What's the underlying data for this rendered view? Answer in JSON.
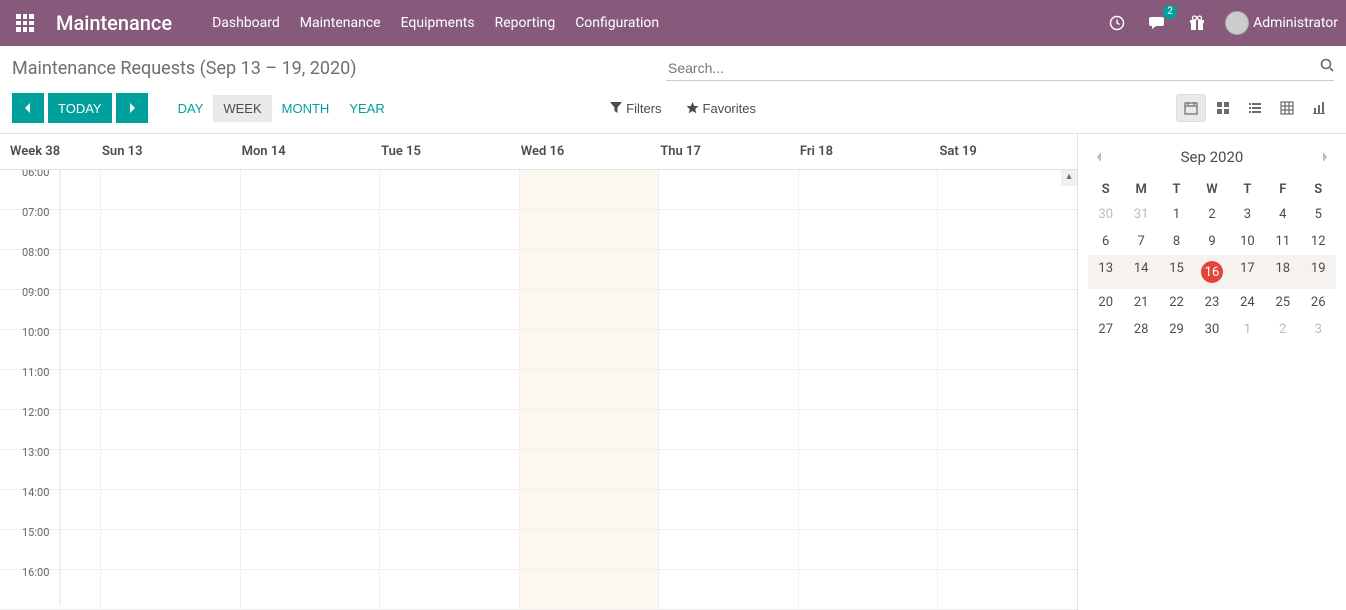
{
  "brand": "Maintenance",
  "nav": {
    "items": [
      "Dashboard",
      "Maintenance",
      "Equipments",
      "Reporting",
      "Configuration"
    ]
  },
  "messaging_badge": "2",
  "user_name": "Administrator",
  "breadcrumb": "Maintenance Requests (Sep 13 – 19, 2020)",
  "search_placeholder": "Search...",
  "toolbar": {
    "today": "TODAY",
    "scales": {
      "day": "DAY",
      "week": "WEEK",
      "month": "MONTH",
      "year": "YEAR"
    },
    "filters": "Filters",
    "favorites": "Favorites"
  },
  "calendar": {
    "week_label": "Week 38",
    "day_headers": [
      "Sun 13",
      "Mon 14",
      "Tue 15",
      "Wed 16",
      "Thu 17",
      "Fri 18",
      "Sat 19"
    ],
    "today_index": 3,
    "time_slots": [
      "06:00",
      "07:00",
      "08:00",
      "09:00",
      "10:00",
      "11:00",
      "12:00",
      "13:00",
      "14:00",
      "15:00",
      "16:00"
    ]
  },
  "mini": {
    "title": "Sep 2020",
    "dow": [
      "S",
      "M",
      "T",
      "W",
      "T",
      "F",
      "S"
    ],
    "weeks": [
      [
        {
          "d": "30",
          "muted": true
        },
        {
          "d": "31",
          "muted": true
        },
        {
          "d": "1"
        },
        {
          "d": "2"
        },
        {
          "d": "3"
        },
        {
          "d": "4"
        },
        {
          "d": "5"
        }
      ],
      [
        {
          "d": "6"
        },
        {
          "d": "7"
        },
        {
          "d": "8"
        },
        {
          "d": "9"
        },
        {
          "d": "10"
        },
        {
          "d": "11"
        },
        {
          "d": "12"
        }
      ],
      [
        {
          "d": "13"
        },
        {
          "d": "14"
        },
        {
          "d": "15"
        },
        {
          "d": "16",
          "today": true
        },
        {
          "d": "17"
        },
        {
          "d": "18"
        },
        {
          "d": "19"
        }
      ],
      [
        {
          "d": "20"
        },
        {
          "d": "21"
        },
        {
          "d": "22"
        },
        {
          "d": "23"
        },
        {
          "d": "24"
        },
        {
          "d": "25"
        },
        {
          "d": "26"
        }
      ],
      [
        {
          "d": "27"
        },
        {
          "d": "28"
        },
        {
          "d": "29"
        },
        {
          "d": "30"
        },
        {
          "d": "1",
          "muted": true
        },
        {
          "d": "2",
          "muted": true
        },
        {
          "d": "3",
          "muted": true
        }
      ]
    ],
    "current_week_index": 2
  }
}
